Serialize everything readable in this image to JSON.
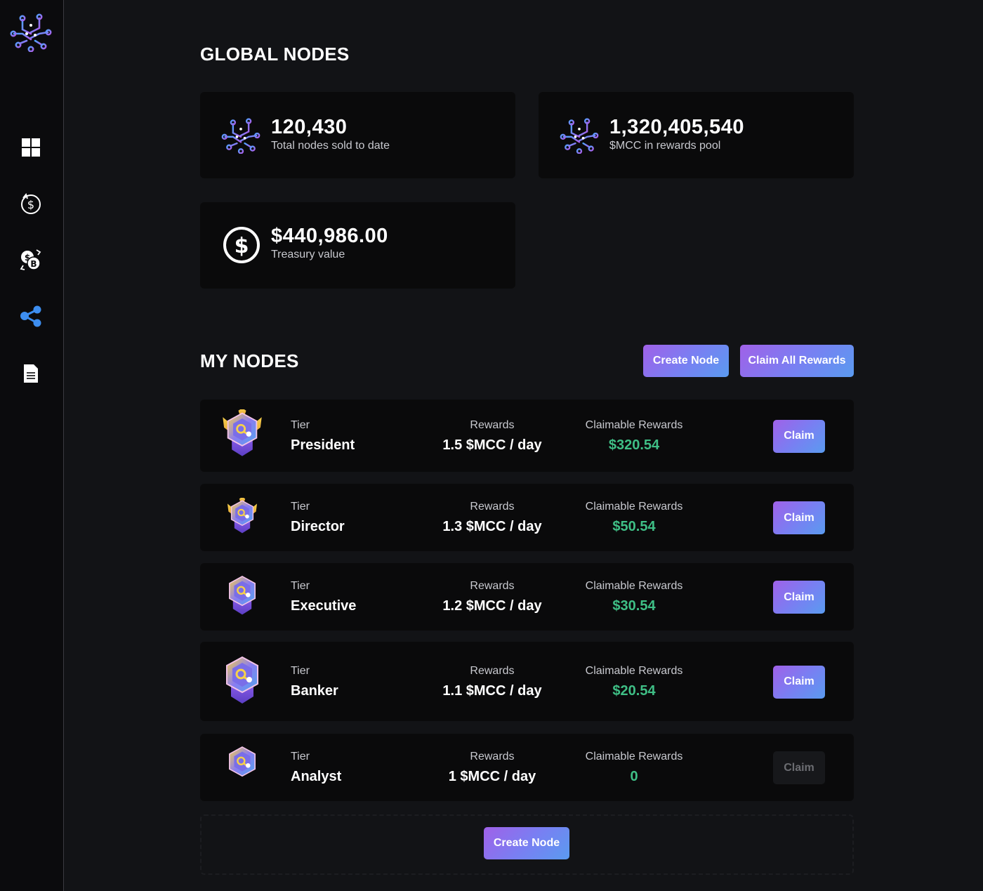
{
  "sidebar": {
    "items": [
      {
        "icon": "dashboard-grid-icon"
      },
      {
        "icon": "dollar-refresh-icon"
      },
      {
        "icon": "currency-exchange-icon"
      },
      {
        "icon": "share-network-icon"
      },
      {
        "icon": "document-icon"
      }
    ]
  },
  "global": {
    "title": "GLOBAL NODES",
    "stats": [
      {
        "value": "120,430",
        "label": "Total nodes sold to date"
      },
      {
        "value": "1,320,405,540",
        "label": "$MCC in rewards pool"
      },
      {
        "value": "$440,986.00",
        "label": "Treasury value"
      }
    ]
  },
  "my_nodes": {
    "title": "MY NODES",
    "create_label": "Create Node",
    "claim_all_label": "Claim All Rewards",
    "tier_label": "Tier",
    "rewards_label": "Rewards",
    "claimable_label": "Claimable Rewards",
    "claim_label": "Claim",
    "rows": [
      {
        "tier": "President",
        "rewards": "1.5 $MCC / day",
        "claimable": "$320.54"
      },
      {
        "tier": "Director",
        "rewards": "1.3 $MCC / day",
        "claimable": "$50.54"
      },
      {
        "tier": "Executive",
        "rewards": "1.2 $MCC / day",
        "claimable": "$30.54"
      },
      {
        "tier": "Banker",
        "rewards": "1.1 $MCC / day",
        "claimable": "$20.54"
      },
      {
        "tier": "Analyst",
        "rewards": "1 $MCC / day",
        "claimable": "0"
      }
    ],
    "bottom_create_label": "Create Node"
  },
  "colors": {
    "background": "#121316",
    "card": "#0a0a0b",
    "accent_start": "#a061e8",
    "accent_end": "#5a9bf0",
    "claimable_green": "#3fbf86"
  }
}
